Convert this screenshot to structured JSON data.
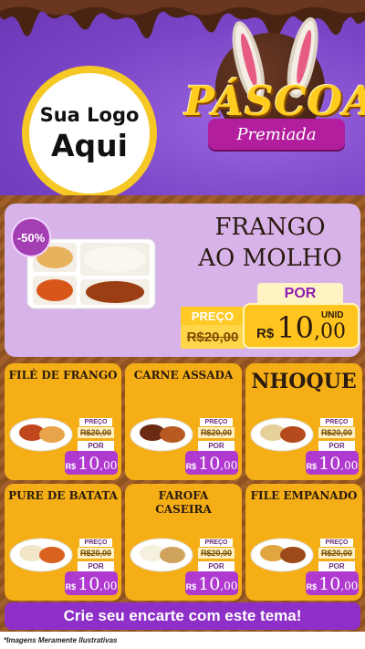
{
  "header": {
    "logo_line1": "Sua Logo",
    "logo_line2": "Aqui",
    "brand_title": "PÁSCOA",
    "brand_subtitle": "Premiada"
  },
  "colors": {
    "header_bg": "#7b45c7",
    "card_bg": "#f5ae16",
    "hero_bg": "#d7b3ea",
    "price_purple": "#b03ad0",
    "cta_bg": "#8e2fc7"
  },
  "hero": {
    "discount_badge": "-50%",
    "title_line1": "FRANGO",
    "title_line2": "AO MOLHO",
    "por_label": "POR",
    "preco_label": "PREÇO",
    "old_price": "R$20,00",
    "currency": "R$",
    "price_int": "10",
    "price_cents": ",00",
    "unit": "UNID"
  },
  "products": [
    {
      "title": "FILÉ DE FRANGO",
      "preco_label": "PREÇO",
      "old_price": "R$20,00",
      "por_label": "POR",
      "currency": "R$",
      "price_int": "10",
      "price_cents": ",00"
    },
    {
      "title": "CARNE ASSADA",
      "preco_label": "PREÇO",
      "old_price": "R$20,00",
      "por_label": "POR",
      "currency": "R$",
      "price_int": "10",
      "price_cents": ",00"
    },
    {
      "title": "NHOQUE",
      "preco_label": "PREÇO",
      "old_price": "R$20,00",
      "por_label": "POR",
      "currency": "R$",
      "price_int": "10",
      "price_cents": ",00"
    },
    {
      "title": "PURE DE BATATA",
      "preco_label": "PREÇO",
      "old_price": "R$20,00",
      "por_label": "POR",
      "currency": "R$",
      "price_int": "10",
      "price_cents": ",00"
    },
    {
      "title": "FAROFA CASEIRA",
      "preco_label": "PREÇO",
      "old_price": "R$20,00",
      "por_label": "POR",
      "currency": "R$",
      "price_int": "10",
      "price_cents": ",00"
    },
    {
      "title": "FILE EMPANADO",
      "preco_label": "PREÇO",
      "old_price": "R$20,00",
      "por_label": "POR",
      "currency": "R$",
      "price_int": "10",
      "price_cents": ",00"
    }
  ],
  "cta": {
    "label": "Crie seu encarte com este tema!"
  },
  "footnote": "*Imagens Meramente Ilustrativas"
}
